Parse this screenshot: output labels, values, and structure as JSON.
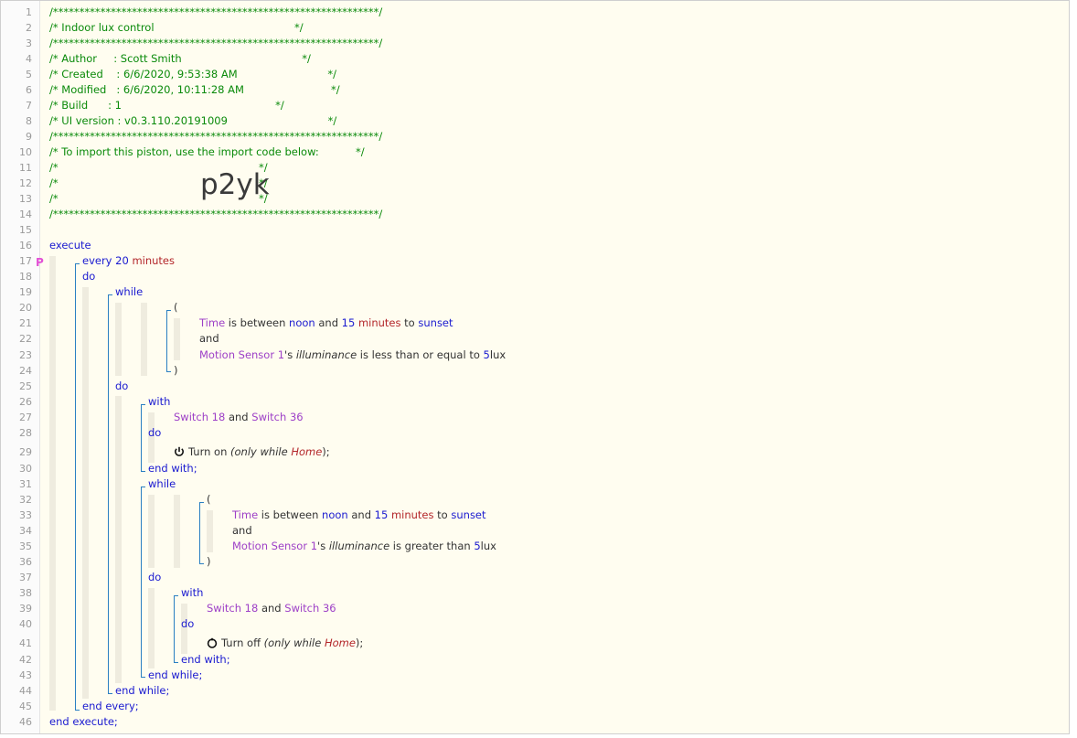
{
  "editor": {
    "line_numbers": [
      "1",
      "2",
      "3",
      "4",
      "5",
      "6",
      "7",
      "8",
      "9",
      "10",
      "11",
      "12",
      "13",
      "14",
      "15",
      "16",
      "17",
      "18",
      "19",
      "20",
      "21",
      "22",
      "23",
      "24",
      "25",
      "26",
      "27",
      "28",
      "29",
      "30",
      "31",
      "32",
      "33",
      "34",
      "35",
      "36",
      "37",
      "38",
      "39",
      "40",
      "41",
      "42",
      "43",
      "44",
      "45",
      "46"
    ],
    "header": {
      "stars": "/**************************************************************/",
      "title_line": "/* Indoor lux control                                          */",
      "author_line": "/* Author     : Scott Smith                                    */",
      "created_line": "/* Created    : 6/6/2020, 9:53:38 AM                           */",
      "modified_line": "/* Modified   : 6/6/2020, 10:11:28 AM                          */",
      "build_line": "/* Build      : 1                                              */",
      "ui_line": "/* UI version : v0.3.110.20191009                              */",
      "import_line": "/* To import this piston, use the import code below:           */",
      "blank_line": "/*                                                            */",
      "import_code": "p2yk"
    },
    "kw": {
      "execute": "execute",
      "every": "every",
      "do": "do",
      "while": "while",
      "with": "with",
      "and": "and",
      "end_with": "end with;",
      "end_while": "end while;",
      "end_every": "end every;",
      "end_execute": "end execute;",
      "open_paren": "(",
      "close_paren": ")"
    },
    "every_value": "20",
    "every_unit": "minutes",
    "cond": {
      "time": "Time",
      "is_between": " is between ",
      "noon": "noon",
      "and_word": " and ",
      "fifteen": "15",
      "minutes": " minutes",
      "to_word": " to ",
      "sunset": "sunset",
      "motion_sensor": "Motion Sensor 1",
      "possessive": "'s ",
      "illuminance": "illuminance",
      "less_equal": " is less than or equal to ",
      "greater": " is greater than ",
      "five": "5",
      "lux": "lux"
    },
    "devices": {
      "switch18": "Switch 18",
      "and_word": " and ",
      "switch36": "Switch 36"
    },
    "actions": {
      "turn_on": "Turn on",
      "turn_off": "Turn off",
      "only_while": "(only while ",
      "home": "Home",
      "close": ");"
    },
    "colors": {
      "comment": "#0a8a0a",
      "keyword": "#1a1ad0",
      "device": "#9d3fc7",
      "variable": "#b3262a",
      "background": "#fffdf0"
    }
  }
}
